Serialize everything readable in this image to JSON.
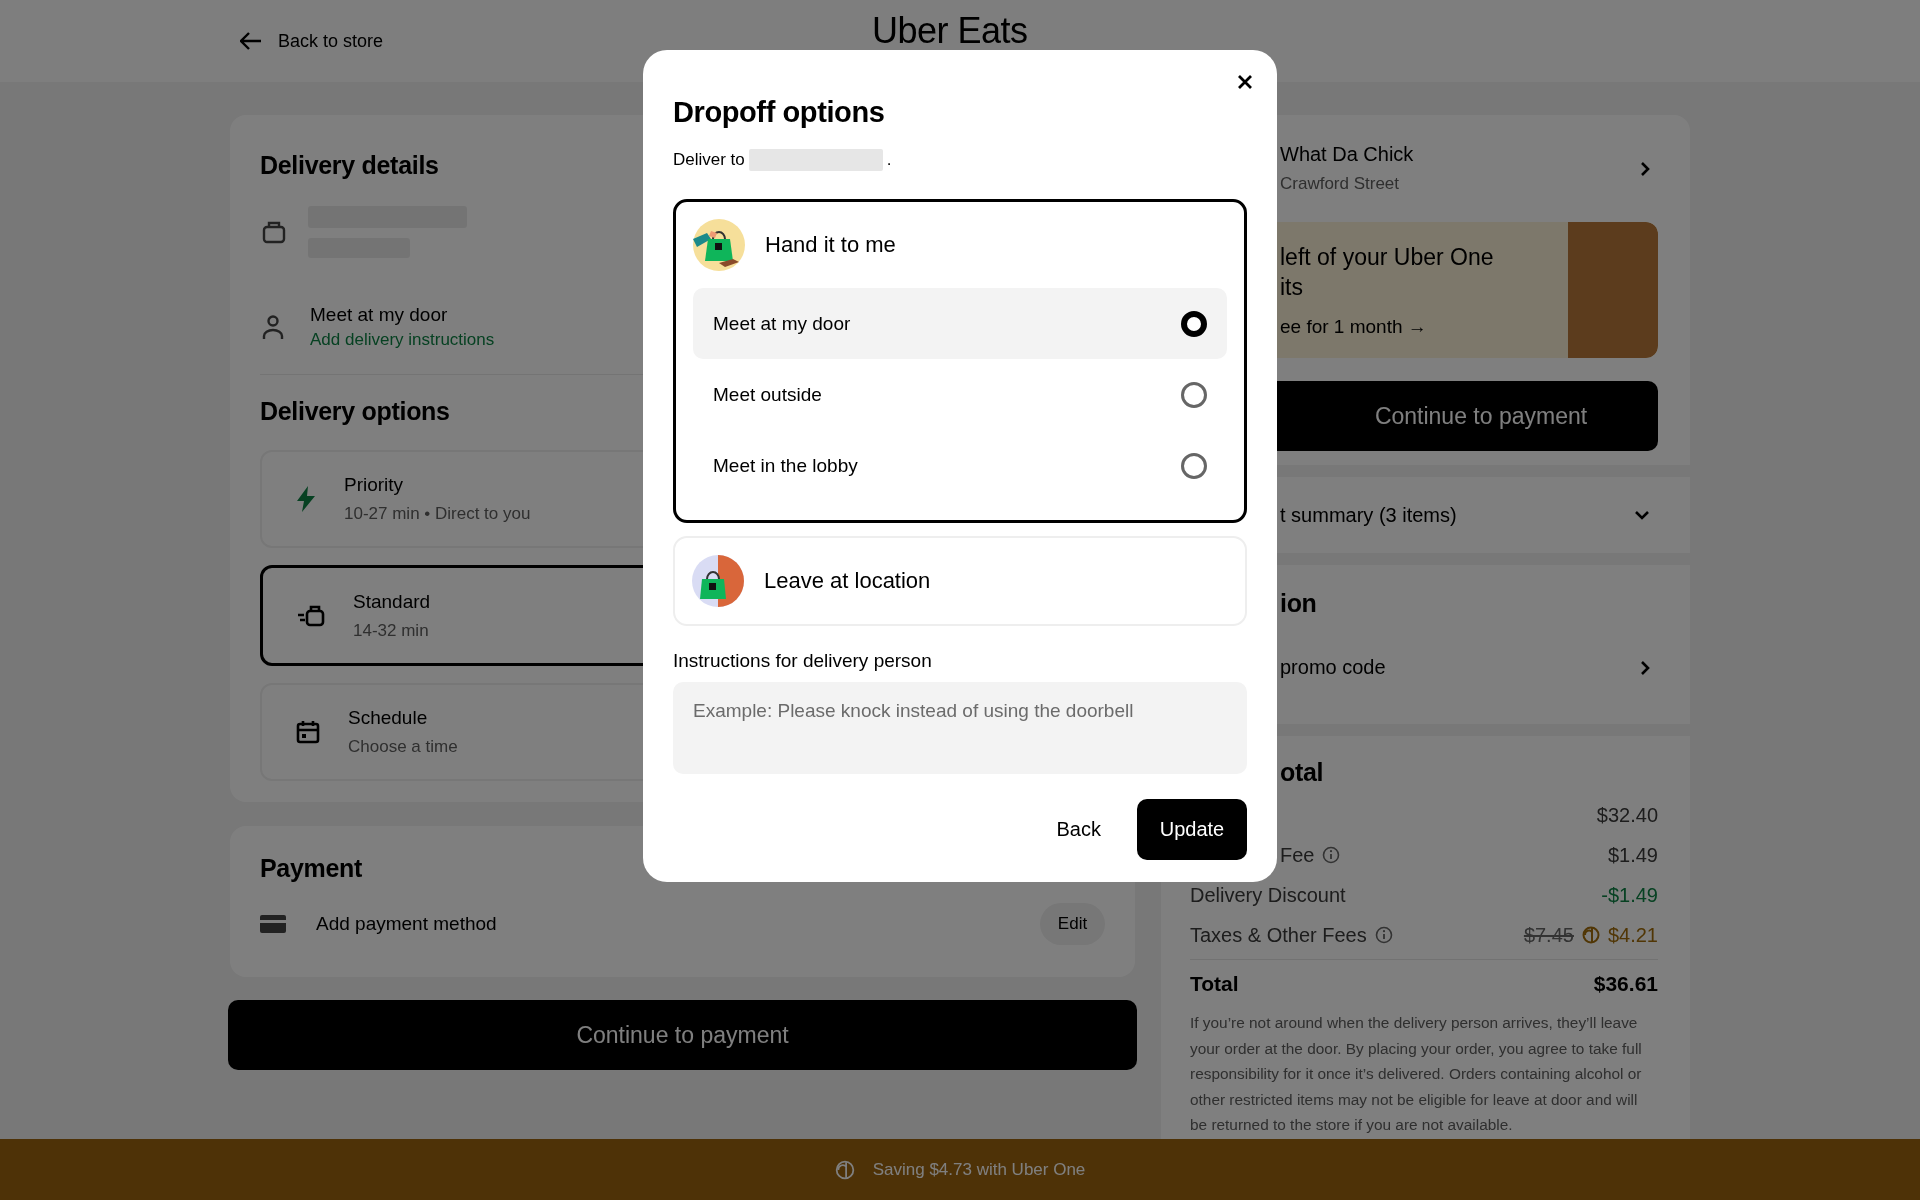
{
  "header": {
    "back_link": "Back to store",
    "logo": "Uber Eats"
  },
  "delivery_details": {
    "title": "Delivery details",
    "dropoff_title": "Meet at my door",
    "dropoff_link": "Add delivery instructions"
  },
  "delivery_options": {
    "title": "Delivery options",
    "options": [
      {
        "kind": "priority",
        "title": "Priority",
        "subtitle": "10-27 min • Direct to you",
        "selected": false
      },
      {
        "kind": "standard",
        "title": "Standard",
        "subtitle": "14-32 min",
        "selected": true
      },
      {
        "kind": "schedule",
        "title": "Schedule",
        "subtitle": "Choose a time",
        "selected": false
      }
    ]
  },
  "payment": {
    "title": "Payment",
    "method": "Add payment method",
    "edit_button": "Edit"
  },
  "continue_button": "Continue to payment",
  "cart": {
    "store_name": "What Da Chick",
    "store_address": "Crawford Street",
    "promo": {
      "line_1": "left of your Uber One",
      "line_2": "its",
      "link": "ee for 1 month →"
    },
    "continue_button": "Continue to payment",
    "summary": "t summary (3 items)",
    "promotion": {
      "title": "ion",
      "promo_code": "promo code"
    },
    "totals": {
      "title": "otal",
      "rows": [
        {
          "kind": "plain",
          "value": "$32.40"
        },
        {
          "kind": "plain",
          "label": "Fee",
          "info": true,
          "value": "$1.49"
        },
        {
          "kind": "discount",
          "label": "Delivery Discount",
          "info": false,
          "value": "-$1.49"
        },
        {
          "kind": "member",
          "label": "Taxes & Other Fees",
          "info": true,
          "original_value": "$7.45",
          "value": "$4.21"
        }
      ],
      "total_label": "Total",
      "total_value": "$36.61"
    },
    "disclaimer": "If you’re not around when the delivery person arrives, they’ll leave your order at the door. By placing your order, you agree to take full responsibility for it once it’s delivered. Orders containing alcohol or other restricted items may not be eligible for leave at door and will be returned to the store if you are not available."
  },
  "footer_banner": "Saving $4.73 with Uber One",
  "modal": {
    "title": "Dropoff options",
    "deliver_to": "Deliver to",
    "address_suffix": ".",
    "groups": [
      {
        "kind": "hand",
        "title": "Hand it to me",
        "expanded": true,
        "options": [
          {
            "label": "Meet at my door",
            "selected": true
          },
          {
            "label": "Meet outside",
            "selected": false
          },
          {
            "label": "Meet in the lobby",
            "selected": false
          }
        ]
      },
      {
        "kind": "leave",
        "title": "Leave at location",
        "expanded": false
      }
    ],
    "instructions_label": "Instructions for delivery person",
    "instructions_placeholder": "Example: Please knock instead of using the doorbell",
    "back_button": "Back",
    "update_button": "Update"
  }
}
